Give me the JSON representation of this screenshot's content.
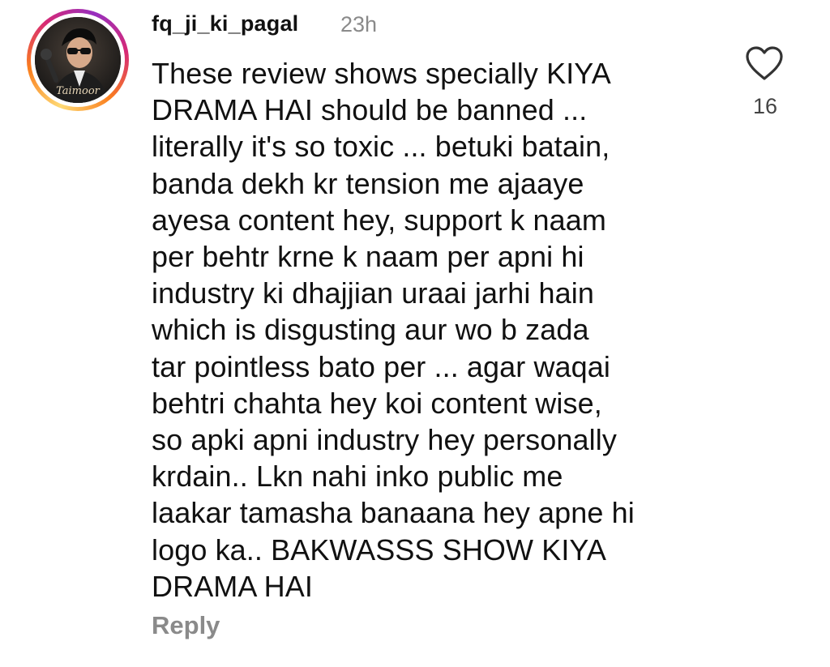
{
  "comment": {
    "username": "fq_ji_ki_pagal",
    "timestamp": "23h",
    "avatar_signature": "Taimoor",
    "text": "These review shows specially KIYA\nDRAMA HAI should be banned ...\nliterally it's so toxic ... betuki batain,\nbanda dekh kr tension me ajaaye\nayesa content hey, support k naam\nper behtr krne k naam per apni hi\nindustry ki dhajjian uraai jarhi hain\nwhich is disgusting aur wo b zada\ntar pointless bato per ... agar waqai\nbehtri chahta hey koi content wise,\nso apki apni industry hey personally\nkrdain.. Lkn nahi inko public me\nlaakar tamasha banaana hey apne hi\nlogo ka.. BAKWASSS SHOW KIYA\nDRAMA HAI",
    "reply_label": "Reply",
    "like_count": "16",
    "like_icon": "heart-outline-icon"
  },
  "colors": {
    "text": "#111111",
    "muted": "#8a8a8a",
    "background": "#ffffff"
  }
}
